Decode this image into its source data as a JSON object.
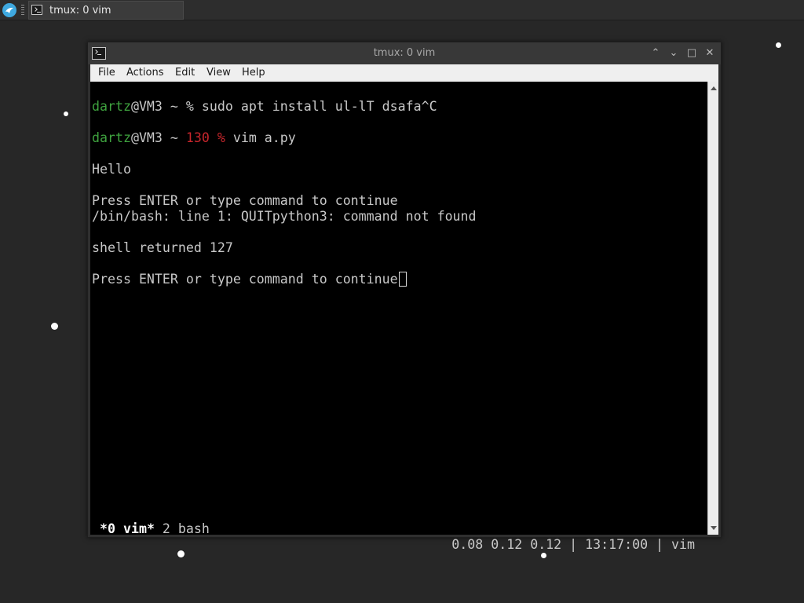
{
  "taskbar": {
    "task_label": "tmux: 0 vim"
  },
  "window": {
    "title": "tmux: 0 vim",
    "controls": {
      "minimize": "⌃",
      "restore": "⌄",
      "maximize": "□",
      "close": "✕"
    }
  },
  "menu": {
    "items": [
      "File",
      "Actions",
      "Edit",
      "View",
      "Help"
    ]
  },
  "terminal": {
    "line1": {
      "user": "dartz",
      "host": "@VM3 ~ % ",
      "cmd": "sudo apt install ul-lT dsafa^C"
    },
    "line2": {
      "user": "dartz",
      "host": "@VM3 ~ ",
      "code": "130 %",
      "cmd": " vim a.py"
    },
    "line3": "Hello",
    "line4": "Press ENTER or type command to continue",
    "line5": "/bin/bash: line 1: QUITpython3: command not found",
    "line6": "shell returned 127",
    "line7": "Press ENTER or type command to continue"
  },
  "status": {
    "active_window": "*0 vim*",
    "other_window": " 2 bash",
    "right": "0.08 0.12 0.12 | 13:17:00 | vim"
  },
  "colors": {
    "prompt_user": "#3fa33f",
    "exit_code": "#c8262c",
    "terminal_bg": "#000000",
    "desktop_bg": "#272727"
  }
}
